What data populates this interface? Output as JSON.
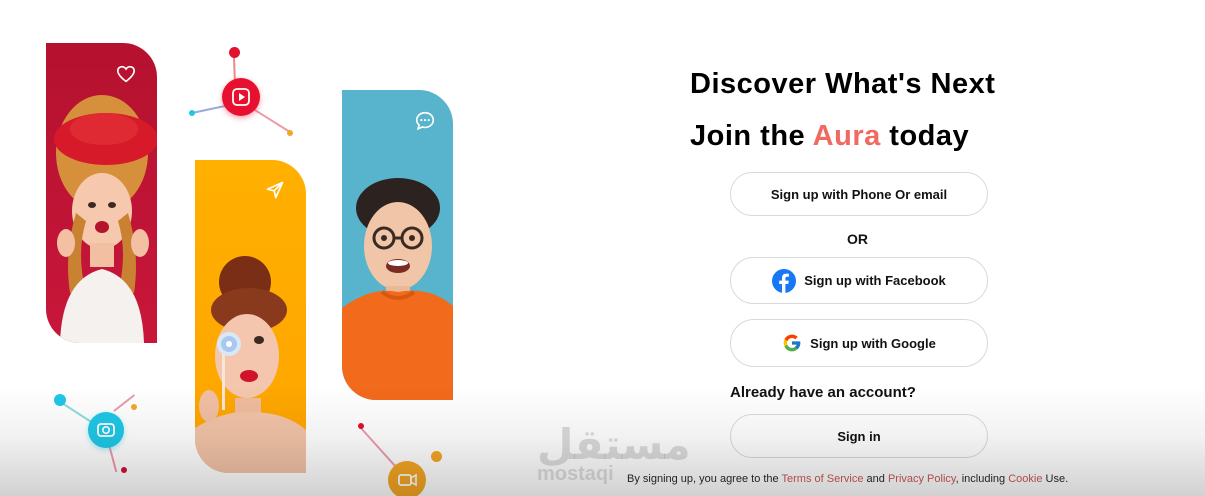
{
  "heading": {
    "line1": "Discover What's Next",
    "line2_prefix": "Join the",
    "brand": "Aura",
    "line2_suffix": "today",
    "brand_color": "#f06a61"
  },
  "buttons": {
    "phone_email": "Sign up with Phone Or email",
    "facebook": "Sign up with Facebook",
    "google": "Sign up with Google",
    "sign_in": "Sign in"
  },
  "or_label": "OR",
  "already_label": "Already have an account?",
  "legal": {
    "prefix": "By signing up, you agree to the",
    "terms": "Terms of Service",
    "and": "and",
    "privacy": "Privacy Policy",
    "including": ", including",
    "cookie": "Cookie",
    "suffix": "Use."
  },
  "watermark": {
    "arabic": "مستقل",
    "latin": "mostaqi"
  },
  "icons": {
    "red_card": "heart-icon",
    "yellow_card": "send-icon",
    "blue_card": "chat-icon",
    "red_node": "play-icon",
    "cyan_node": "camera-icon",
    "orange_node": "video-icon"
  },
  "colors": {
    "red": "#c8163a",
    "yellow": "#ffa400",
    "blue": "#58b4cc",
    "cyan": "#1ec7e6",
    "facebook": "#1877f2"
  }
}
